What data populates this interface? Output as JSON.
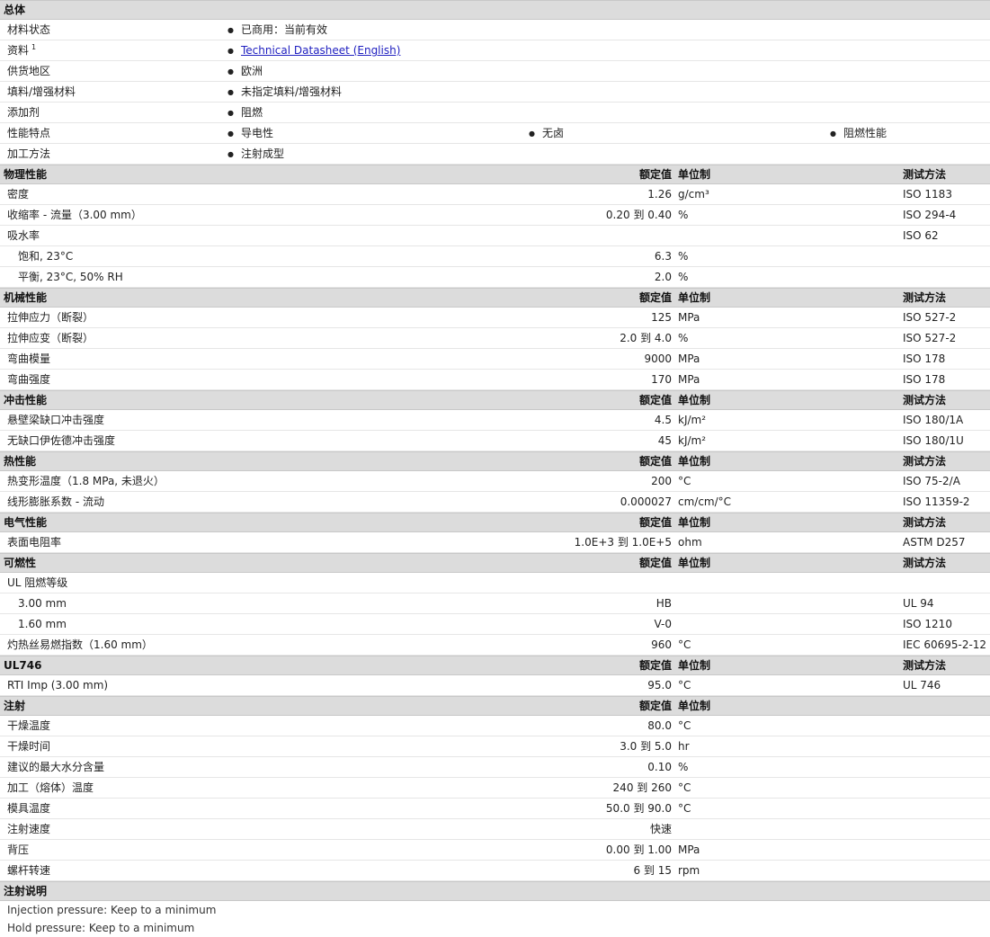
{
  "general": {
    "title": "总体",
    "rows": [
      {
        "label": "材料状态",
        "bullets": [
          "已商用：当前有效"
        ]
      },
      {
        "label": "资料",
        "sup": "1",
        "bullets": [
          "Technical Datasheet (English)"
        ],
        "link": true
      },
      {
        "label": "供货地区",
        "bullets": [
          "欧洲"
        ]
      },
      {
        "label": "填料/增强材料",
        "bullets": [
          "未指定填料/增强材料"
        ]
      },
      {
        "label": "添加剂",
        "bullets": [
          "阻燃"
        ]
      },
      {
        "label": "性能特点",
        "bullets": [
          "导电性",
          "无卤",
          "阻燃性能"
        ]
      },
      {
        "label": "加工方法",
        "bullets": [
          "注射成型"
        ]
      }
    ]
  },
  "col_headers": {
    "value": "额定值",
    "unit": "单位制",
    "method": "测试方法"
  },
  "sections": [
    {
      "title": "物理性能",
      "has_method": true,
      "rows": [
        {
          "label": "密度",
          "value": "1.26",
          "unit": "g/cm³",
          "method": "ISO 1183"
        },
        {
          "label": "收缩率 - 流量（3.00 mm）",
          "value": "0.20 到  0.40",
          "unit": "%",
          "method": "ISO 294-4"
        },
        {
          "label": "吸水率",
          "value": "",
          "unit": "",
          "method": "ISO 62"
        },
        {
          "label": "饱和, 23°C",
          "value": "6.3",
          "unit": "%",
          "method": "",
          "sub": true
        },
        {
          "label": "平衡, 23°C, 50% RH",
          "value": "2.0",
          "unit": "%",
          "method": "",
          "sub": true
        }
      ]
    },
    {
      "title": "机械性能",
      "has_method": true,
      "rows": [
        {
          "label": "拉伸应力（断裂）",
          "value": "125",
          "unit": "MPa",
          "method": "ISO 527-2"
        },
        {
          "label": "拉伸应变（断裂）",
          "value": "2.0 到  4.0",
          "unit": "%",
          "method": "ISO 527-2"
        },
        {
          "label": "弯曲模量",
          "value": "9000",
          "unit": "MPa",
          "method": "ISO 178"
        },
        {
          "label": "弯曲强度",
          "value": "170",
          "unit": "MPa",
          "method": "ISO 178"
        }
      ]
    },
    {
      "title": "冲击性能",
      "has_method": true,
      "rows": [
        {
          "label": "悬壁梁缺口冲击强度",
          "value": "4.5",
          "unit": "kJ/m²",
          "method": "ISO 180/1A"
        },
        {
          "label": "无缺口伊佐德冲击强度",
          "value": "45",
          "unit": "kJ/m²",
          "method": "ISO 180/1U"
        }
      ]
    },
    {
      "title": "热性能",
      "has_method": true,
      "rows": [
        {
          "label": "热变形温度（1.8 MPa, 未退火）",
          "value": "200",
          "unit": "°C",
          "method": "ISO 75-2/A"
        },
        {
          "label": "线形膨胀系数 - 流动",
          "value": "0.000027",
          "unit": "cm/cm/°C",
          "method": "ISO 11359-2"
        }
      ]
    },
    {
      "title": "电气性能",
      "has_method": true,
      "rows": [
        {
          "label": "表面电阻率",
          "value": "1.0E+3 到  1.0E+5",
          "unit": "ohm",
          "method": "ASTM D257"
        }
      ]
    },
    {
      "title": "可燃性",
      "has_method": true,
      "rows": [
        {
          "label": "UL 阻燃等级",
          "value": "",
          "unit": "",
          "method": ""
        },
        {
          "label": "3.00 mm",
          "value": "HB",
          "unit": "",
          "method": "UL 94",
          "sub": true
        },
        {
          "label": "1.60 mm",
          "value": "V-0",
          "unit": "",
          "method": "ISO 1210",
          "sub": true
        },
        {
          "label": "灼热丝易燃指数（1.60 mm）",
          "value": "960",
          "unit": "°C",
          "method": "IEC 60695-2-12"
        }
      ]
    },
    {
      "title": "UL746",
      "has_method": true,
      "rows": [
        {
          "label": "RTI Imp (3.00 mm)",
          "value": "95.0",
          "unit": "°C",
          "method": "UL 746"
        }
      ]
    },
    {
      "title": "注射",
      "has_method": false,
      "rows": [
        {
          "label": "干燥温度",
          "value": "80.0",
          "unit": "°C",
          "method": ""
        },
        {
          "label": "干燥时间",
          "value": "3.0 到  5.0",
          "unit": "hr",
          "method": ""
        },
        {
          "label": "建议的最大水分含量",
          "value": "0.10",
          "unit": "%",
          "method": ""
        },
        {
          "label": "加工（熔体）温度",
          "value": "240 到  260",
          "unit": "°C",
          "method": ""
        },
        {
          "label": "模具温度",
          "value": "50.0 到  90.0",
          "unit": "°C",
          "method": ""
        },
        {
          "label": "注射速度",
          "value": "快速",
          "unit": "",
          "method": ""
        },
        {
          "label": "背压",
          "value": "0.00 到  1.00",
          "unit": "MPa",
          "method": ""
        },
        {
          "label": "螺杆转速",
          "value": "6 到  15",
          "unit": "rpm",
          "method": ""
        }
      ]
    }
  ],
  "notes": {
    "title": "注射说明",
    "lines": [
      "Injection pressure: Keep to a minimum",
      "Hold pressure: Keep to a minimum"
    ]
  }
}
